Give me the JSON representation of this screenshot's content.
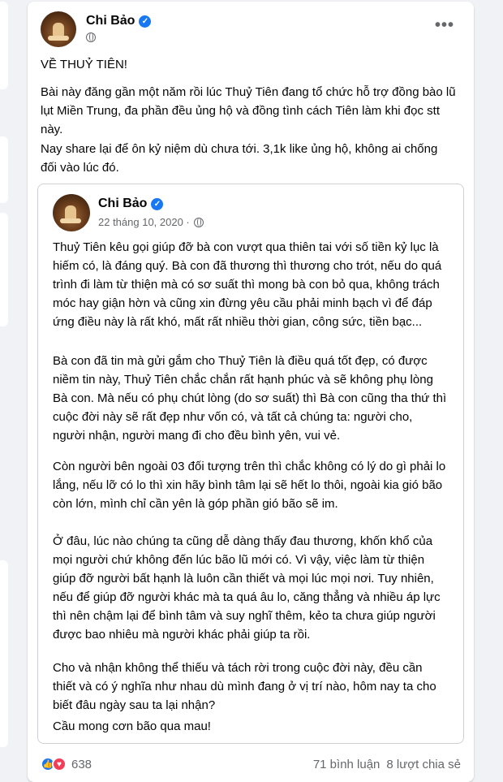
{
  "post": {
    "author": "Chi Bảo",
    "title_line": "VỀ THUỶ TIÊN!",
    "paragraph_1": "Bài này đăng gần một năm rồi lúc Thuỷ Tiên đang tổ chức hỗ trợ đồng bào lũ lụt Miền Trung, đa phần đều ủng hộ và đồng tình cách Tiên làm khi đọc stt này.",
    "paragraph_2": "Nay share lại để ôn kỷ niệm dù chưa tới. 3,1k like ủng hộ, không ai chống đối vào lúc đó.",
    "more_icon": "more-horizontal-icon"
  },
  "shared_post": {
    "author": "Chi Bảo",
    "date": "22 tháng 10, 2020 ·",
    "paragraphs": [
      "Thuỷ Tiên kêu gọi giúp đỡ bà con vượt qua thiên tai với số tiền kỷ lục là hiếm có, là đáng quý. Bà con đã thương thì thương cho trót, nếu do quá trình đi làm từ thiện mà có sơ suất thì mong bà con bỏ qua, không trách móc hay giận hờn và cũng xin đừng yêu cầu phải minh bạch vì để đáp ứng điều này là rất khó, mất rất nhiều thời gian, công sức, tiền bạc...",
      "Bà con đã tin mà gửi gắm cho Thuỷ Tiên là điều quá tốt đẹp, có được niềm tin này, Thuỷ Tiên chắc chắn rất hạnh phúc và sẽ không phụ lòng Bà con. Mà nếu có phụ chút lòng (do sơ suất) thì Bà con cũng tha thứ thì cuộc đời này sẽ rất đẹp như vốn có, và tất cả chúng ta: người cho, người nhận, người mang đi cho đều bình yên, vui vẻ.",
      "Còn người bên ngoài 03 đối tượng trên thì chắc không có lý do gì phải lo lắng, nếu lỡ có lo thì xin hãy bình tâm lại sẽ hết lo thôi, ngoài kia gió bão còn lớn, mình chỉ cần yên là góp phần gió bão sẽ im.",
      "Ở đâu, lúc nào chúng ta cũng dễ dàng thấy đau thương, khốn khổ của mọi người chứ không đến lúc bão lũ mới có. Vì vậy, việc làm từ thiện giúp đỡ người bất hạnh là luôn cần thiết và mọi lúc mọi nơi. Tuy nhiên, nếu để giúp đỡ người khác mà ta quá âu lo, căng thẳng và nhiều áp lực thì nên chậm lại để bình tâm và suy nghĩ thêm, kẻo ta chưa giúp người được bao nhiêu mà người khác phải giúp ta rồi.",
      "Cho và nhận không thể thiếu và tách rời trong cuộc đời này, đều cần thiết và có ý nghĩa như nhau dù mình đang ở vị trí nào, hôm nay ta cho biết đâu ngày sau ta lại nhận?",
      "Cầu mong cơn bão qua mau!"
    ]
  },
  "footer": {
    "reaction_count": "638",
    "comments": "71 bình luận",
    "shares": "8 lượt chia sẻ"
  },
  "colors": {
    "accent": "#1877f2",
    "love": "#f33e58",
    "secondary_text": "#65676b"
  }
}
